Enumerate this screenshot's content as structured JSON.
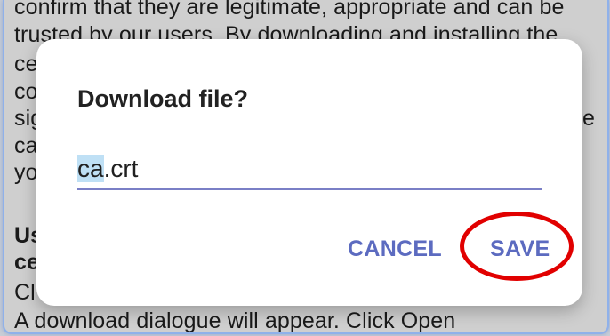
{
  "background": {
    "lines": [
      "confirm that they are legitimate, appropriate and can be",
      "trusted by our users. By downloading and installing the",
      "ce",
      "co",
      "sig",
      "ca",
      "yo",
      "Us",
      "ce",
      "Cl",
      "A download dialogue will appear. Click Open"
    ],
    "right_fragment": "e"
  },
  "dialog": {
    "title": "Download file?",
    "filename_selected": "ca",
    "filename_rest": ".crt",
    "cancel_label": "CANCEL",
    "save_label": "SAVE"
  },
  "colors": {
    "accent": "#5c6bc0",
    "highlight_ring": "#e10000",
    "selection": "#bfe0f5",
    "frame_border": "#8fb1ea"
  }
}
